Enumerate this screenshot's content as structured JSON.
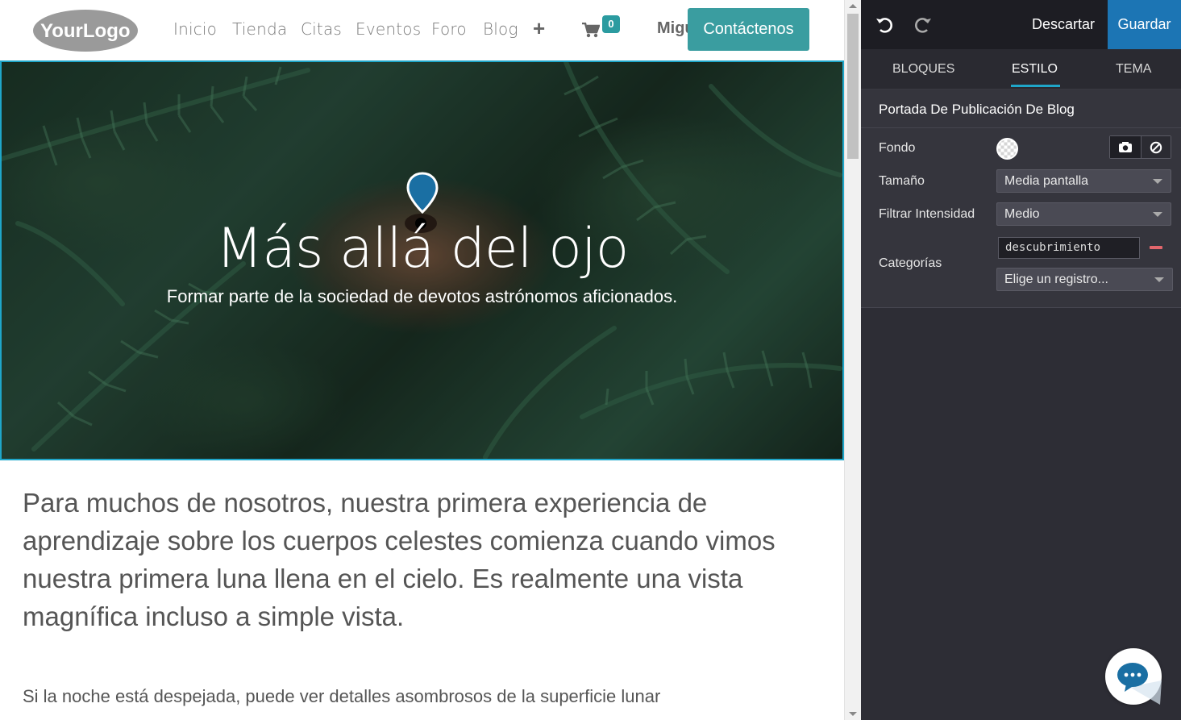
{
  "navbar": {
    "logo_text": "YourLogo",
    "links": [
      "Inicio",
      "Tienda",
      "Citas",
      "Eventos",
      "Foro",
      "Blog"
    ],
    "plus_icon": "plus-icon",
    "cart_count": "0",
    "user_name": "Miguel",
    "contact_label": "Contáctenos"
  },
  "hero": {
    "title": "Más allá del ojo",
    "subtitle": "Formar parte de la sociedad de devotos astrónomos aficionados.",
    "pin_icon": "map-pin-icon"
  },
  "article": {
    "lead": "Para muchos de nosotros, nuestra primera experiencia de aprendizaje sobre los cuerpos celestes comienza cuando vimos nuestra primera luna llena en el cielo. Es realmente una vista magnífica incluso a simple vista.",
    "paragraph": "Si la noche está despejada, puede ver detalles asombrosos de la superficie lunar"
  },
  "editor": {
    "undo_icon": "undo-icon",
    "redo_icon": "redo-icon",
    "discard_label": "Descartar",
    "save_label": "Guardar",
    "tabs": [
      "BLOQUES",
      "ESTILO",
      "TEMA"
    ],
    "active_tab": "ESTILO",
    "section_title": "Portada De Publicación De Blog",
    "rows": {
      "background_label": "Fondo",
      "size_label": "Tamaño",
      "size_value": "Media pantalla",
      "filter_label": "Filtrar Intensidad",
      "filter_value": "Medio",
      "categories_label": "Categorías",
      "category_tag": "descubrimiento",
      "category_placeholder": "Elige un registro..."
    }
  },
  "colors": {
    "accent": "#1fa6c9",
    "save": "#1c75b4",
    "contact": "#3a9da0",
    "remove": "#e2666c"
  }
}
